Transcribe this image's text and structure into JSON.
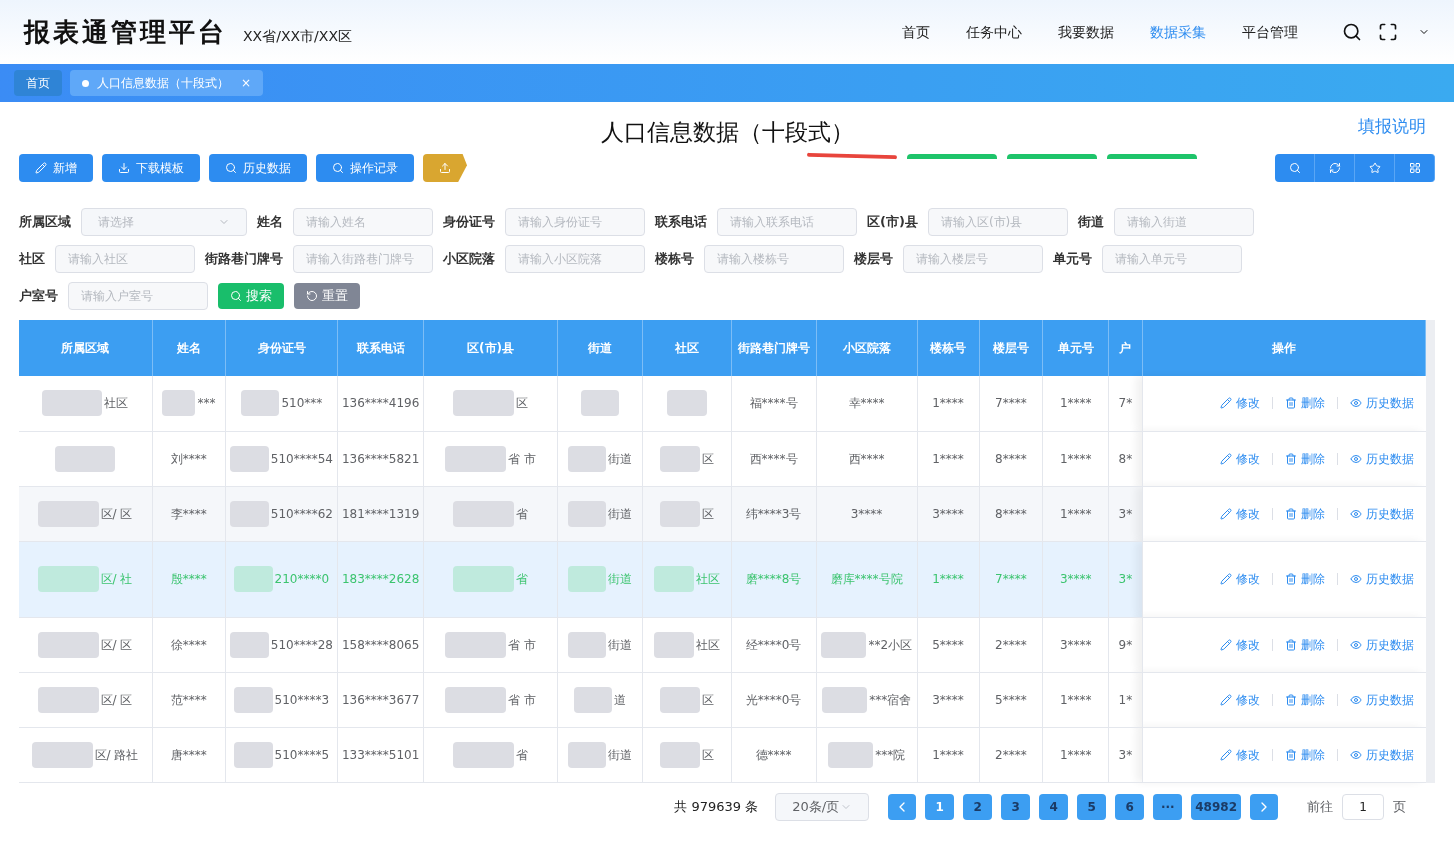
{
  "brand": {
    "name": "报表通管理平台",
    "region": "XX省/XX市/XX区"
  },
  "nav": [
    {
      "label": "首页",
      "selected": false
    },
    {
      "label": "任务中心",
      "selected": false
    },
    {
      "label": "我要数据",
      "selected": false
    },
    {
      "label": "数据采集",
      "selected": true
    },
    {
      "label": "平台管理",
      "selected": false
    }
  ],
  "tabs": [
    {
      "label": "首页",
      "selected": false
    },
    {
      "label": "人口信息数据（十段式）",
      "selected": true,
      "close": "×"
    }
  ],
  "page_title": "人口信息数据（十段式）",
  "help_link": "填报说明",
  "toolbar": [
    {
      "kind": "add",
      "label": "新增"
    },
    {
      "kind": "download",
      "label": "下载模板"
    },
    {
      "kind": "search",
      "label": "历史数据"
    },
    {
      "kind": "search",
      "label": "操作记录"
    },
    {
      "kind": "upload"
    }
  ],
  "filters": [
    [
      {
        "label": "所属区域",
        "placeholder": "请选择",
        "kind": "select"
      },
      {
        "label": "姓名",
        "placeholder": "请输入姓名",
        "kind": "input"
      },
      {
        "label": "身份证号",
        "placeholder": "请输入身份证号",
        "kind": "input"
      },
      {
        "label": "联系电话",
        "placeholder": "请输入联系电话",
        "kind": "input"
      },
      {
        "label": "区(市)县",
        "placeholder": "请输入区(市)县",
        "kind": "input"
      },
      {
        "label": "街道",
        "placeholder": "请输入街道",
        "kind": "input"
      }
    ],
    [
      {
        "label": "社区",
        "placeholder": "请输入社区",
        "kind": "input"
      },
      {
        "label": "街路巷门牌号",
        "placeholder": "请输入街路巷门牌号",
        "kind": "input"
      },
      {
        "label": "小区院落",
        "placeholder": "请输入小区院落",
        "kind": "input"
      },
      {
        "label": "楼栋号",
        "placeholder": "请输入楼栋号",
        "kind": "input"
      },
      {
        "label": "楼层号",
        "placeholder": "请输入楼层号",
        "kind": "input"
      },
      {
        "label": "单元号",
        "placeholder": "请输入单元号",
        "kind": "input"
      }
    ],
    [
      {
        "label": "户室号",
        "placeholder": "请输入户室号",
        "kind": "input"
      }
    ]
  ],
  "search_button": "搜索",
  "reset_button": "重置",
  "table": {
    "columns": [
      "所属区域",
      "姓名",
      "身份证号",
      "联系电话",
      "区(市)县",
      "街道",
      "社区",
      "街路巷门牌号",
      "小区院落",
      "楼栋号",
      "楼层号",
      "单元号",
      "户",
      "操作"
    ],
    "rows": [
      {
        "selected": false,
        "cells": [
          {
            "text": "社区",
            "redacted": true
          },
          {
            "text": "***",
            "redacted": true
          },
          {
            "text": "510***",
            "redacted": true
          },
          "136****4196",
          {
            "text": "区",
            "redacted": true
          },
          {
            "text": "",
            "redacted": true
          },
          {
            "text": "",
            "redacted": true
          },
          "福****号",
          "幸****",
          "1****",
          "7****",
          "1****",
          "7*"
        ],
        "actions": [
          "修改",
          "删除",
          "历史数据"
        ]
      },
      {
        "selected": false,
        "cells": [
          {
            "text": "",
            "redacted": true
          },
          "刘****",
          {
            "text": "510****54",
            "redacted": true
          },
          "136****5821",
          {
            "text": "省 市",
            "redacted": true
          },
          {
            "text": "街道",
            "redacted": true
          },
          {
            "text": "区",
            "redacted": true
          },
          "西****号",
          "西****",
          "1****",
          "8****",
          "1****",
          "8*"
        ],
        "actions": [
          "修改",
          "删除",
          "历史数据"
        ]
      },
      {
        "selected": false,
        "cells": [
          {
            "text": "区/ 区",
            "redacted": true
          },
          "李****",
          {
            "text": "510****62",
            "redacted": true
          },
          "181****1319",
          {
            "text": "省",
            "redacted": true
          },
          {
            "text": "街道",
            "redacted": true
          },
          {
            "text": "区",
            "redacted": true
          },
          "纬****3号",
          "3****",
          "3****",
          "8****",
          "1****",
          "3*"
        ],
        "actions": [
          "修改",
          "删除",
          "历史数据"
        ]
      },
      {
        "selected": true,
        "cells": [
          {
            "text": "区/ 社",
            "redacted": true
          },
          "殷****",
          {
            "text": "210****0",
            "redacted": true
          },
          "183****2628",
          {
            "text": "省",
            "redacted": true
          },
          {
            "text": "街道",
            "redacted": true
          },
          {
            "text": "社区",
            "redacted": true
          },
          "磨****8号",
          "磨库****号院",
          "1****",
          "7****",
          "3****",
          "3*"
        ],
        "actions": [
          "修改",
          "删除",
          "历史数据"
        ]
      },
      {
        "selected": false,
        "cells": [
          {
            "text": "区/ 区",
            "redacted": true
          },
          "徐****",
          {
            "text": "510****28",
            "redacted": true
          },
          "158****8065",
          {
            "text": "省 市",
            "redacted": true
          },
          {
            "text": "街道",
            "redacted": true
          },
          {
            "text": "社区",
            "redacted": true
          },
          "经****0号",
          {
            "text": "**2小区",
            "redacted": true
          },
          "5****",
          "2****",
          "3****",
          "9*"
        ],
        "actions": [
          "修改",
          "删除",
          "历史数据"
        ]
      },
      {
        "selected": false,
        "cells": [
          {
            "text": "区/ 区",
            "redacted": true
          },
          "范****",
          {
            "text": "510****3",
            "redacted": true
          },
          "136****3677",
          {
            "text": "省 市",
            "redacted": true
          },
          {
            "text": "道",
            "redacted": true
          },
          {
            "text": "区",
            "redacted": true
          },
          "光****0号",
          {
            "text": "***宿舍",
            "redacted": true
          },
          "3****",
          "5****",
          "1****",
          "1*"
        ],
        "actions": [
          "修改",
          "删除",
          "历史数据"
        ]
      },
      {
        "selected": false,
        "cells": [
          {
            "text": "区/ 路社",
            "redacted": true
          },
          "唐****",
          {
            "text": "510****5",
            "redacted": true
          },
          "133****5101",
          {
            "text": "省",
            "redacted": true
          },
          {
            "text": "街道",
            "redacted": true
          },
          {
            "text": "区",
            "redacted": true
          },
          "德****",
          {
            "text": "***院",
            "redacted": true
          },
          "1****",
          "2****",
          "1****",
          "3*"
        ],
        "actions": [
          "修改",
          "删除",
          "历史数据"
        ]
      }
    ]
  },
  "pagination": {
    "total": "共 979639 条",
    "page_size": "20条/页",
    "pages": [
      {
        "label": "1",
        "selected": true
      },
      {
        "label": "2",
        "selected": false
      },
      {
        "label": "3",
        "selected": false
      },
      {
        "label": "4",
        "selected": false
      },
      {
        "label": "5",
        "selected": false
      },
      {
        "label": "6",
        "selected": false
      },
      {
        "label": "···",
        "selected": false
      },
      {
        "label": "48982",
        "selected": false
      }
    ],
    "goto_label": "前往",
    "goto_value": "1",
    "goto_unit": "页"
  }
}
